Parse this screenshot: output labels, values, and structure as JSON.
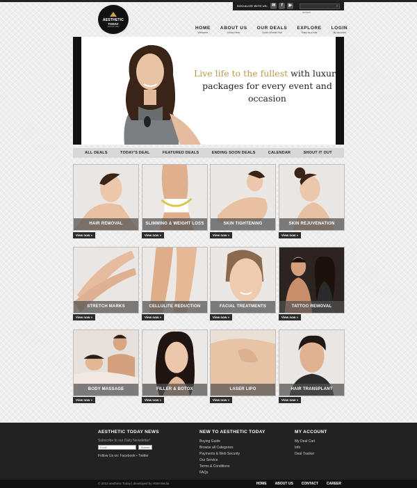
{
  "logo": {
    "line1": "AESTHETIC",
    "line2": "TODAY",
    "line3": "aesthetic today"
  },
  "social": {
    "label": "SOCIALIZE WITH US:",
    "icons": [
      "email-icon",
      "facebook-icon",
      "youtube-icon"
    ],
    "search_placeholder": "search"
  },
  "nav": [
    {
      "title": "HOME",
      "sub": "Welcome"
    },
    {
      "title": "ABOUT US",
      "sub": "Know Here"
    },
    {
      "title": "OUR DEALS",
      "sub": "Touch Worlds Hub"
    },
    {
      "title": "EXPLORE",
      "sub": "Easy as a ride"
    },
    {
      "title": "LOGIN",
      "sub": "My account"
    }
  ],
  "hero": {
    "tagline_gold": "Live life to the fullest",
    "tagline_rest_1": " with luxury",
    "tagline_line2": "packages for every event and occasion"
  },
  "categories": [
    "ALL DEALS",
    "TODAY'S DEAL",
    "FEATURED DEALS",
    "ENDING SOON DEALS",
    "CALENDAR",
    "SHOUT IT OUT"
  ],
  "tiles": [
    {
      "label": "HAIR REMOVAL",
      "button": "View now »"
    },
    {
      "label": "SLIMMING & WEIGHT LOSS",
      "button": "View now »"
    },
    {
      "label": "SKIN TIGHTENING",
      "button": "View now »"
    },
    {
      "label": "SKIN REJUVENATION",
      "button": "View now »"
    },
    {
      "label": "STRETCH MARKS",
      "button": "View now »"
    },
    {
      "label": "CELLULITE REDUCTION",
      "button": "View now »"
    },
    {
      "label": "FACIAL TREATMENTS",
      "button": "View now »"
    },
    {
      "label": "TATTOO REMOVAL",
      "button": "View now »"
    },
    {
      "label": "BODY MASSAGE",
      "button": "View now »"
    },
    {
      "label": "FILLER & BOTOX",
      "button": "View now »"
    },
    {
      "label": "LASER LIPO",
      "button": "View now »"
    },
    {
      "label": "HAIR TRANSPLANT",
      "button": "View now »"
    }
  ],
  "footer": {
    "news": {
      "title": "AESTHETIC TODAY NEWS",
      "subscribe": "Subscribe to our Daily Newsletter!",
      "email_placeholder": "Email",
      "submit": "Submit",
      "follow": "Follow Us on: Facebook • Twitter"
    },
    "new_to": {
      "title": "NEW TO AESTHETIC TODAY",
      "links": [
        "Buying Guide",
        "Browse all Categories",
        "Payments & Web Security",
        "Our Service",
        "Terms & Conditions",
        "FAQs"
      ]
    },
    "account": {
      "title": "MY ACCOUNT",
      "links": [
        "My Deal Cart",
        "Info",
        "Deal Tracker"
      ]
    }
  },
  "bottom": {
    "copyright": "© 2013 aesthetic Today | developed by HSM Media",
    "links": [
      "HOME",
      "ABOUT US",
      "CONTACT",
      "CAREER"
    ]
  }
}
